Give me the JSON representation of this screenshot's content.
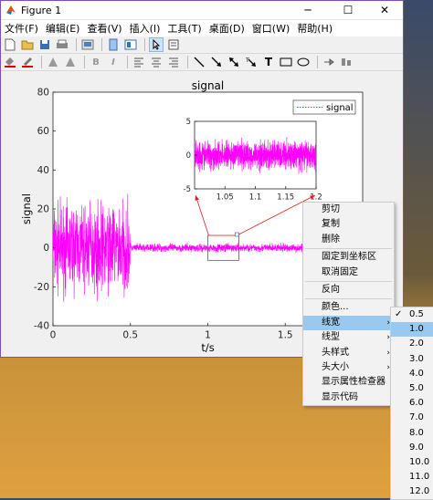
{
  "window": {
    "title": "Figure 1",
    "controls": {
      "minimize": "─",
      "maximize": "☐",
      "close": "✕"
    }
  },
  "menubar": [
    "文件(F)",
    "编辑(E)",
    "查看(V)",
    "插入(I)",
    "工具(T)",
    "桌面(D)",
    "窗口(W)",
    "帮助(H)"
  ],
  "toolbar": {
    "row1": [
      "new-figure-icon",
      "open-icon",
      "save-icon",
      "print-icon",
      "print-preview-icon",
      "link-icon",
      "insert-colorbar-icon",
      "pointer-icon",
      "property-editor-icon"
    ],
    "row2": [
      "brush-fill-icon",
      "brush-line-icon",
      "text-color-icon",
      "text-icon",
      "bold-icon",
      "italic-icon",
      "align-left-icon",
      "align-center-icon",
      "align-right-icon",
      "line-icon",
      "arrow-icon",
      "double-arrow-icon",
      "text-arrow-icon",
      "textbox-icon",
      "rectangle-icon",
      "ellipse-icon",
      "pin-icon",
      "align-distribute-icon"
    ]
  },
  "chart_data": [
    {
      "type": "line",
      "title": "signal",
      "xlabel": "t/s",
      "ylabel": "signal",
      "xlim": [
        0,
        2
      ],
      "ylim": [
        -40,
        80
      ],
      "xticks": [
        "0",
        "0.5",
        "1",
        "1.5"
      ],
      "yticks": [
        "80",
        "60",
        "40",
        "20",
        "0",
        "-20",
        "-40"
      ],
      "legend": {
        "entries": [
          "signal"
        ],
        "position": "top-right"
      },
      "color": "#ff00ff",
      "series": [
        {
          "name": "signal",
          "segments": [
            {
              "x_range": [
                0,
                0.5
              ],
              "amplitude": 32
            },
            {
              "x_range": [
                0.5,
                2
              ],
              "amplitude": 3
            }
          ]
        }
      ],
      "zoom_region": {
        "x": [
          1.0,
          1.2
        ],
        "y": [
          -5,
          5
        ]
      }
    },
    {
      "type": "line",
      "title": "",
      "xlim": [
        1.0,
        1.2
      ],
      "ylim": [
        -5,
        5
      ],
      "xticks": [
        "1.05",
        "1.1",
        "1.15",
        "1.2"
      ],
      "yticks": [
        "5",
        "0",
        "-5"
      ],
      "color": "#ff00ff",
      "series": [
        {
          "name": "signal",
          "segments": [
            {
              "x_range": [
                1.0,
                1.2
              ],
              "amplitude": 3
            }
          ]
        }
      ]
    }
  ],
  "context_menu": {
    "items": [
      "剪切",
      "复制",
      "删除",
      "固定到坐标区",
      "取消固定",
      "反向",
      "颜色...",
      "线宽",
      "线型",
      "头样式",
      "头大小",
      "显示属性检查器",
      "显示代码"
    ],
    "highlighted": "线宽",
    "submenu_items": [
      "线宽",
      "线型",
      "头样式",
      "头大小"
    ],
    "submenu_arrow": "›"
  },
  "linewidth_menu": {
    "options": [
      "0.5",
      "1.0",
      "2.0",
      "3.0",
      "4.0",
      "5.0",
      "6.0",
      "7.0",
      "8.0",
      "9.0",
      "10.0",
      "11.0",
      "12.0"
    ],
    "checked": "0.5",
    "hovered": "1.0",
    "check_mark": "✓"
  }
}
